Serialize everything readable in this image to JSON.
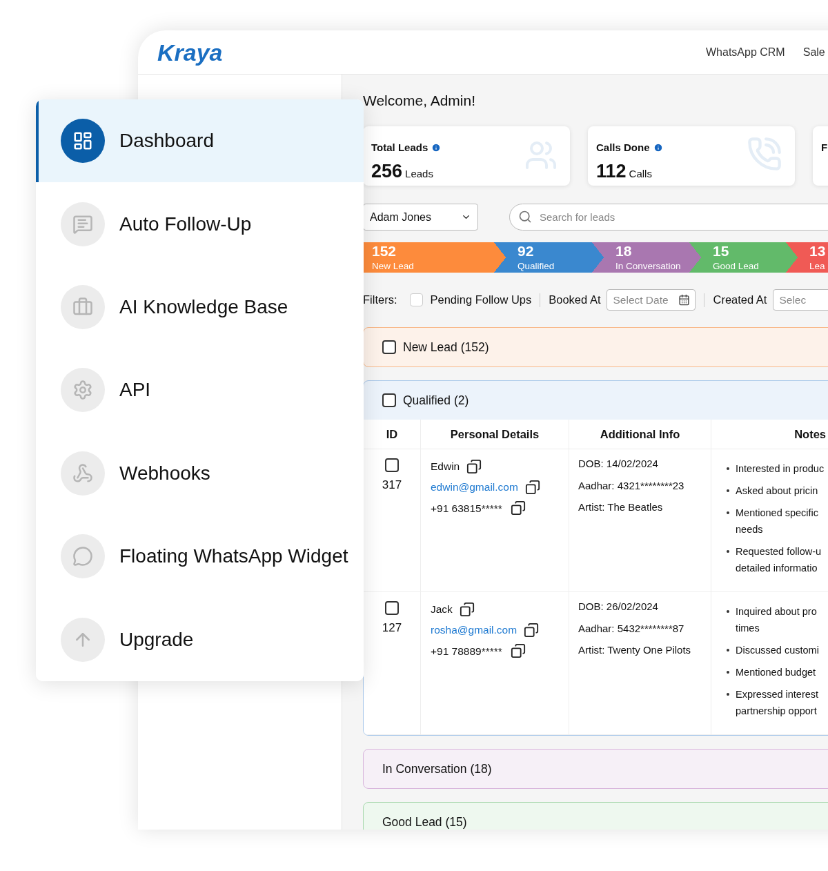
{
  "header": {
    "logo": "Kraya",
    "nav": [
      "WhatsApp CRM",
      "Sale"
    ]
  },
  "sidebar": {
    "items": [
      {
        "label": "Dashboard",
        "selected": true
      },
      {
        "label": "Auto Follow-Up",
        "selected": false
      },
      {
        "label": "AI Knowledge Base",
        "selected": false
      },
      {
        "label": "API",
        "selected": false
      },
      {
        "label": "Webhooks",
        "selected": false
      },
      {
        "label": "Floating WhatsApp Widget",
        "selected": false
      },
      {
        "label": "Upgrade",
        "selected": false
      }
    ]
  },
  "welcome": "Welcome, Admin!",
  "stats": [
    {
      "title": "Total Leads",
      "value": "256",
      "unit": "Leads"
    },
    {
      "title": "Calls Done",
      "value": "112",
      "unit": "Calls"
    },
    {
      "title": "F"
    }
  ],
  "agent_select": {
    "value": "Adam Jones"
  },
  "search": {
    "placeholder": "Search for leads"
  },
  "pipeline": [
    {
      "count": "152",
      "label": "New Lead",
      "color": "#fd8b3c"
    },
    {
      "count": "92",
      "label": "Qualified",
      "color": "#3a88cf"
    },
    {
      "count": "18",
      "label": "In Conversation",
      "color": "#a977b0"
    },
    {
      "count": "15",
      "label": "Good Lead",
      "color": "#62ba6a"
    },
    {
      "count": "13",
      "label": "Lea",
      "color": "#f05a55"
    }
  ],
  "filters": {
    "label": "Filters:",
    "pending": {
      "label": "Pending Follow Ups",
      "checked": false
    },
    "dates": [
      {
        "label": "Booked At",
        "placeholder": "Select Date"
      },
      {
        "label": "Created At",
        "placeholder": "Selec"
      }
    ]
  },
  "sections": [
    {
      "title": "New Lead (152)",
      "checked": false,
      "color": "#f8b98a"
    },
    {
      "title": "Qualified (2)",
      "checked": false,
      "expanded": true,
      "color": "#a9c8ea",
      "columns": [
        "ID",
        "Personal Details",
        "Additional Info",
        "Notes"
      ],
      "rows": [
        {
          "checked": false,
          "id": "317",
          "name": "Edwin",
          "email": "edwin@gmail.com",
          "phone": "+91 63815*****",
          "info": [
            "DOB: 14/02/2024",
            "Aadhar: 4321********23",
            "Artist: The Beatles"
          ],
          "notes": [
            "Interested in produc",
            "Asked about pricin",
            "Mentioned specific\nneeds",
            "Requested follow-u\ndetailed informatio"
          ]
        },
        {
          "checked": false,
          "id": "127",
          "name": "Jack",
          "email": "rosha@gmail.com",
          "phone": "+91 78889*****",
          "info": [
            "DOB: 26/02/2024",
            "Aadhar: 5432********87",
            "Artist: Twenty One Pilots"
          ],
          "notes": [
            "Inquired about pro\ntimes",
            "Discussed customi",
            "Mentioned budget",
            "Expressed interest\npartnership opport"
          ]
        }
      ]
    },
    {
      "title": "In Conversation (18)",
      "color": "#d8b5dc"
    },
    {
      "title": "Good Lead (15)",
      "color": "#a9d8ae"
    }
  ]
}
